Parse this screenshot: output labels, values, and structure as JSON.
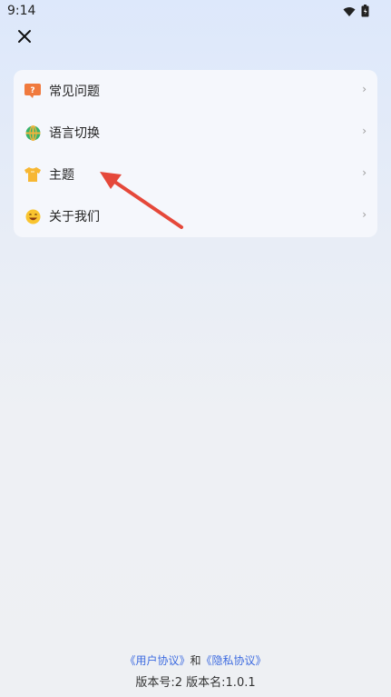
{
  "status_bar": {
    "time": "9:14"
  },
  "menu": {
    "items": [
      {
        "label": "常见问题",
        "icon": "faq-icon"
      },
      {
        "label": "语言切换",
        "icon": "globe-icon"
      },
      {
        "label": "主题",
        "icon": "shirt-icon"
      },
      {
        "label": "关于我们",
        "icon": "smile-icon"
      }
    ],
    "chevron": "›"
  },
  "footer": {
    "user_agreement": "《用户协议》",
    "and": "和",
    "privacy_policy": "《隐私协议》",
    "version": "版本号:2 版本名:1.0.1"
  },
  "colors": {
    "accent_link": "#3d6be0",
    "annotation_arrow": "#e5483a"
  }
}
